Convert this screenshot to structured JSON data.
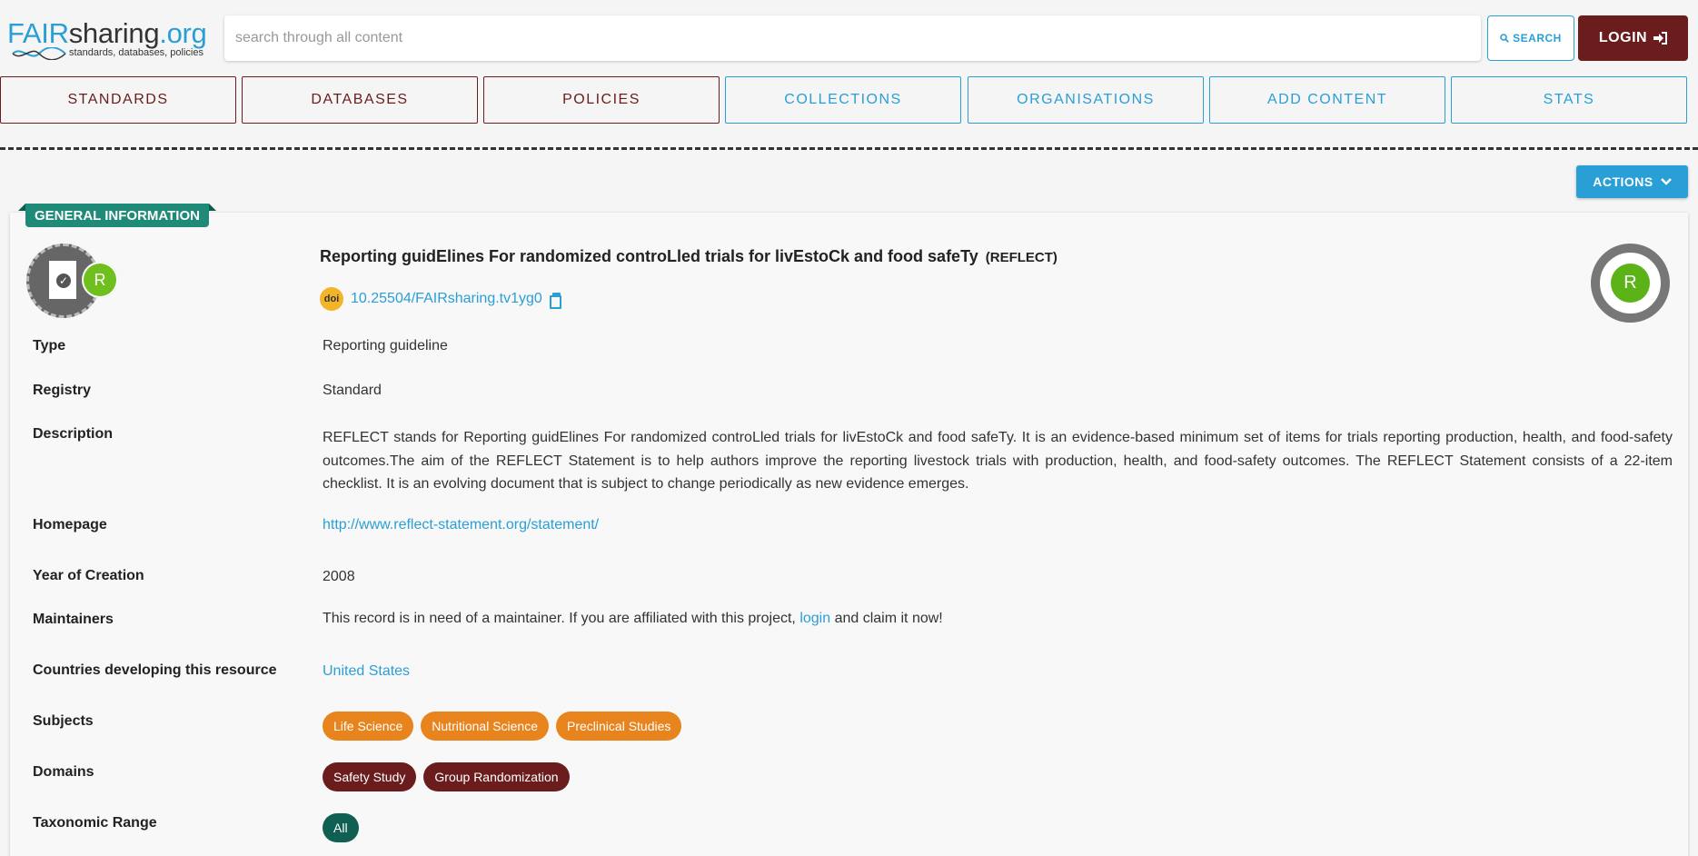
{
  "header": {
    "logo": {
      "fair": "FAIR",
      "sharing": "sharing",
      "org": ".org",
      "tagline": "standards, databases, policies"
    },
    "search_placeholder": "search through all content",
    "search_label": "SEARCH",
    "login_label": "LOGIN"
  },
  "nav": {
    "standards": "STANDARDS",
    "databases": "DATABASES",
    "policies": "POLICIES",
    "collections": "COLLECTIONS",
    "organisations": "ORGANISATIONS",
    "add_content": "ADD CONTENT",
    "stats": "STATS"
  },
  "actions_label": "ACTIONS",
  "record": {
    "section_label": "GENERAL INFORMATION",
    "badge_letter": "R",
    "title": "Reporting guidElines For randomized controLled trials for livEstoCk and food safeTy",
    "abbreviation": "(REFLECT)",
    "doi_logo": "doi",
    "doi": "10.25504/FAIRsharing.tv1yg0",
    "fields": {
      "type_label": "Type",
      "type_value": "Reporting guideline",
      "registry_label": "Registry",
      "registry_value": "Standard",
      "description_label": "Description",
      "description_value": "REFLECT stands for Reporting guidElines For randomized controLled trials for livEstoCk and food safeTy. It is an evidence-based minimum set of items for trials reporting production, health, and food-safety outcomes.The aim of the REFLECT Statement is to help authors improve the reporting livestock trials with production, health, and food-safety outcomes. The REFLECT Statement consists of a 22-item checklist. It is an evolving document that is subject to change periodically as new evidence emerges.",
      "homepage_label": "Homepage",
      "homepage_value": "http://www.reflect-statement.org/statement/",
      "year_label": "Year of Creation",
      "year_value": "2008",
      "maintainers_label": "Maintainers",
      "maintainers_before": "This record is in need of a maintainer. If you are affiliated with this project,",
      "maintainers_link": "login",
      "maintainers_after": "and claim it now!",
      "countries_label": "Countries developing this resource",
      "countries_value": "United States",
      "subjects_label": "Subjects",
      "subjects": [
        "Life Science",
        "Nutritional Science",
        "Preclinical Studies"
      ],
      "domains_label": "Domains",
      "domains": [
        "Safety Study",
        "Group Randomization"
      ],
      "taxonomic_label": "Taxonomic Range",
      "taxonomic": [
        "All"
      ]
    }
  },
  "colors": {
    "brand_blue": "#2a9fd6",
    "maroon": "#6b1c1c",
    "orange": "#e8841e",
    "teal": "#1f8a78",
    "green": "#5bb318"
  }
}
